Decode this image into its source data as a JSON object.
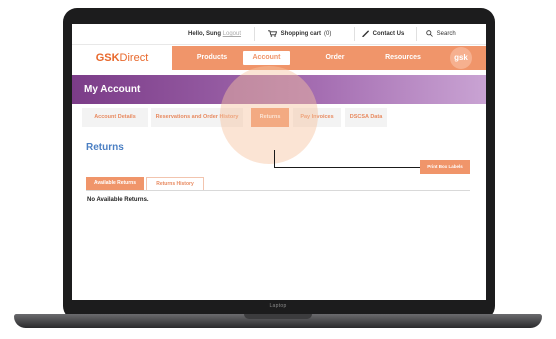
{
  "top_bar": {
    "greeting": "Hello, Sung",
    "logout": "Logout",
    "cart_label": "Shopping cart",
    "cart_count": "(0)",
    "contact": "Contact Us",
    "search": "Search"
  },
  "brand": {
    "logo_bold": "GSK",
    "logo_rest": "Direct",
    "badge": "gsk"
  },
  "main_nav": {
    "items": [
      {
        "label": "Products"
      },
      {
        "label": "Account"
      },
      {
        "label": "Order"
      },
      {
        "label": "Resources"
      }
    ],
    "active": "Account"
  },
  "account": {
    "title": "My Account"
  },
  "sub_tabs": {
    "items": [
      {
        "label": "Account Details"
      },
      {
        "label": "Reservations and Order History"
      },
      {
        "label": "Returns"
      },
      {
        "label": "Pay Invoices"
      },
      {
        "label": "DSCSA Data"
      }
    ],
    "active": "Returns"
  },
  "returns": {
    "heading": "Returns",
    "print_button": "Print Box Labels",
    "tabs": [
      {
        "label": "Available Returns"
      },
      {
        "label": "Returns History"
      }
    ],
    "active_tab": "Available Returns",
    "empty_message": "No Available Returns."
  },
  "device": {
    "label": "Laptop"
  },
  "colors": {
    "accent_orange": "#f0956a",
    "purple": "#7b3c88",
    "link_blue": "#4b7fc3"
  }
}
